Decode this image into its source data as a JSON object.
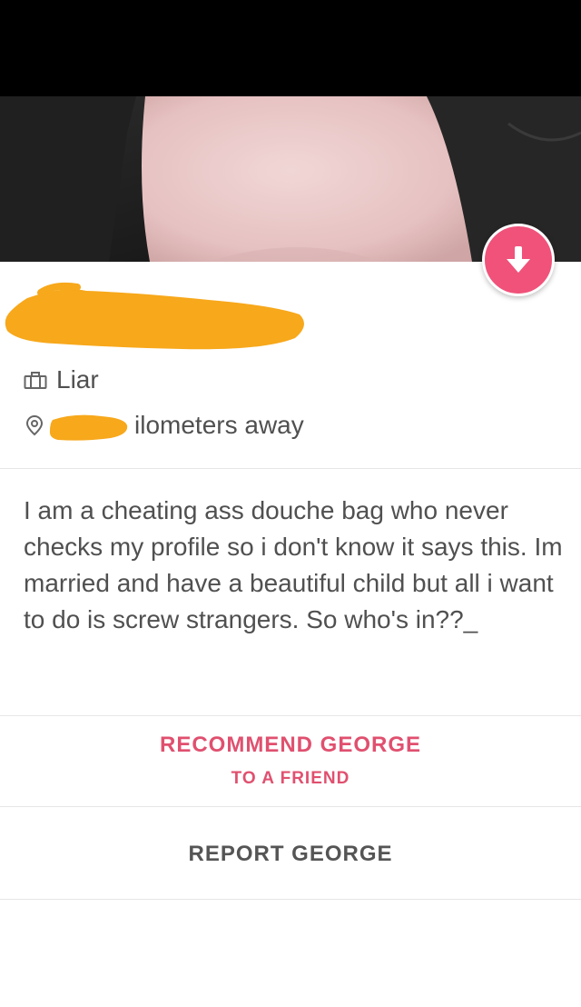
{
  "profile": {
    "job": "Liar",
    "distance_text": "ilometers away",
    "bio": "I am a cheating ass douche bag who never checks my profile so i don't know it says this. Im married and have a beautiful child but all i want to do is screw strangers. So who's in??_"
  },
  "actions": {
    "recommend_title": "RECOMMEND GEORGE",
    "recommend_subtitle": "TO A FRIEND",
    "report_label": "REPORT GEORGE"
  },
  "icons": {
    "job": "briefcase-icon",
    "location": "location-pin-icon",
    "collapse": "arrow-down-icon"
  },
  "colors": {
    "accent": "#f0527a",
    "redaction": "#f7a81b",
    "text": "#505050"
  }
}
